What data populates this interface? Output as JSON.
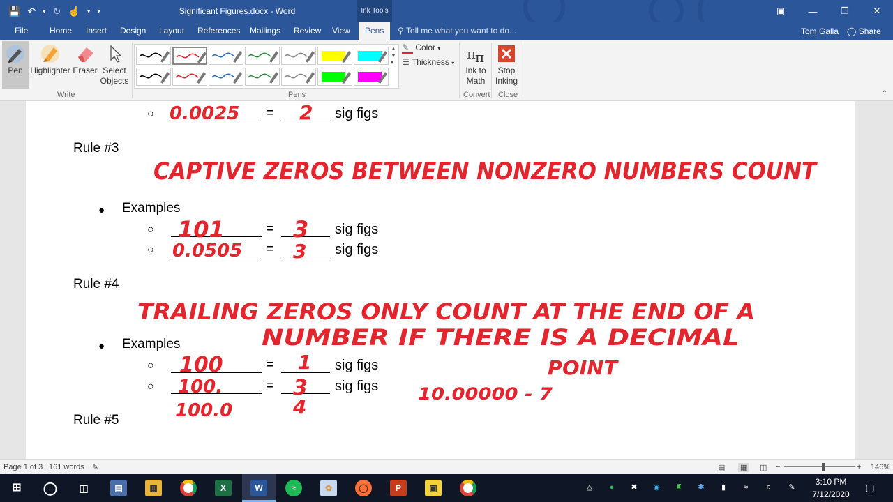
{
  "window": {
    "title": "Significant Figures.docx - Word",
    "contextual_tab_group": "Ink Tools"
  },
  "tabs": [
    "File",
    "Home",
    "Insert",
    "Design",
    "Layout",
    "References",
    "Mailings",
    "Review",
    "View",
    "Pens"
  ],
  "active_tab": "Pens",
  "tell_me_placeholder": "Tell me what you want to do...",
  "user": {
    "name": "Tom Galla",
    "share_label": "Share"
  },
  "ribbon": {
    "write_group": {
      "label": "Write",
      "buttons": [
        {
          "label": "Pen",
          "icon": "pen-icon"
        },
        {
          "label": "Highlighter",
          "icon": "highlighter-icon"
        },
        {
          "label": "Eraser",
          "icon": "eraser-icon"
        },
        {
          "label": "Select Objects",
          "icon": "select-objects-icon"
        }
      ]
    },
    "pens_group": {
      "label": "Pens",
      "pens": [
        {
          "color": "#000000",
          "type": "pen"
        },
        {
          "color": "#e3262d",
          "type": "pen",
          "selected": true
        },
        {
          "color": "#2f6fbf",
          "type": "pen"
        },
        {
          "color": "#2d8a3e",
          "type": "pen"
        },
        {
          "color": "#8a8a8a",
          "type": "pen"
        },
        {
          "color": "#ffff00",
          "type": "highlighter"
        },
        {
          "color": "#00ffff",
          "type": "highlighter"
        },
        {
          "color": "#000000",
          "type": "pen"
        },
        {
          "color": "#e3262d",
          "type": "pen"
        },
        {
          "color": "#2f6fbf",
          "type": "pen"
        },
        {
          "color": "#2d8a3e",
          "type": "pen"
        },
        {
          "color": "#8a8a8a",
          "type": "pen"
        },
        {
          "color": "#00ff00",
          "type": "highlighter"
        },
        {
          "color": "#ff00ff",
          "type": "highlighter"
        }
      ],
      "color_label": "Color",
      "thickness_label": "Thickness"
    },
    "convert_group": {
      "label": "Convert",
      "button": "Ink to Math"
    },
    "close_group": {
      "label": "Close",
      "button": "Stop Inking"
    }
  },
  "document": {
    "top_example": {
      "ink_value": "0.0025",
      "equals": "=",
      "ink_count": "2",
      "suffix": "sig figs"
    },
    "rule3": {
      "heading": "Rule #3",
      "ink_statement": "CAPTIVE ZEROS BETWEEN NONZERO NUMBERS COUNT",
      "bullet": "Examples",
      "examples": [
        {
          "ink_value": "101",
          "equals": "=",
          "ink_count": "3",
          "suffix": "sig figs"
        },
        {
          "ink_value": "0.0505",
          "equals": "=",
          "ink_count": "3",
          "suffix": "sig figs"
        }
      ]
    },
    "rule4": {
      "heading": "Rule #4",
      "ink_statement_lines": [
        "TRAILING ZEROS ONLY COUNT AT THE END OF A",
        "NUMBER IF THERE IS A DECIMAL",
        "POINT"
      ],
      "bullet": "Examples",
      "examples": [
        {
          "ink_value": "100",
          "equals": "=",
          "ink_count": "1",
          "suffix": "sig figs"
        },
        {
          "ink_value": "100.",
          "equals": "=",
          "ink_count": "3",
          "suffix": "sig figs"
        }
      ],
      "ink_extra_value": "100.0",
      "ink_extra_count": "4",
      "ink_side_note": "10.00000 - 7"
    },
    "rule5": {
      "heading": "Rule #5"
    }
  },
  "statusbar": {
    "page": "Page 1 of 3",
    "words": "161 words",
    "zoom": "146%",
    "zoom_level": 0.53
  },
  "taskbar": {
    "apps": [
      "start",
      "cortana",
      "task-view",
      "app-thumbnail",
      "file-explorer",
      "chrome",
      "excel",
      "word",
      "spotify",
      "paint-3d",
      "firefox",
      "powerpoint",
      "sticky-notes",
      "chrome-profile"
    ],
    "active_app": "word",
    "time": "3:10 PM",
    "date": "7/12/2020"
  }
}
